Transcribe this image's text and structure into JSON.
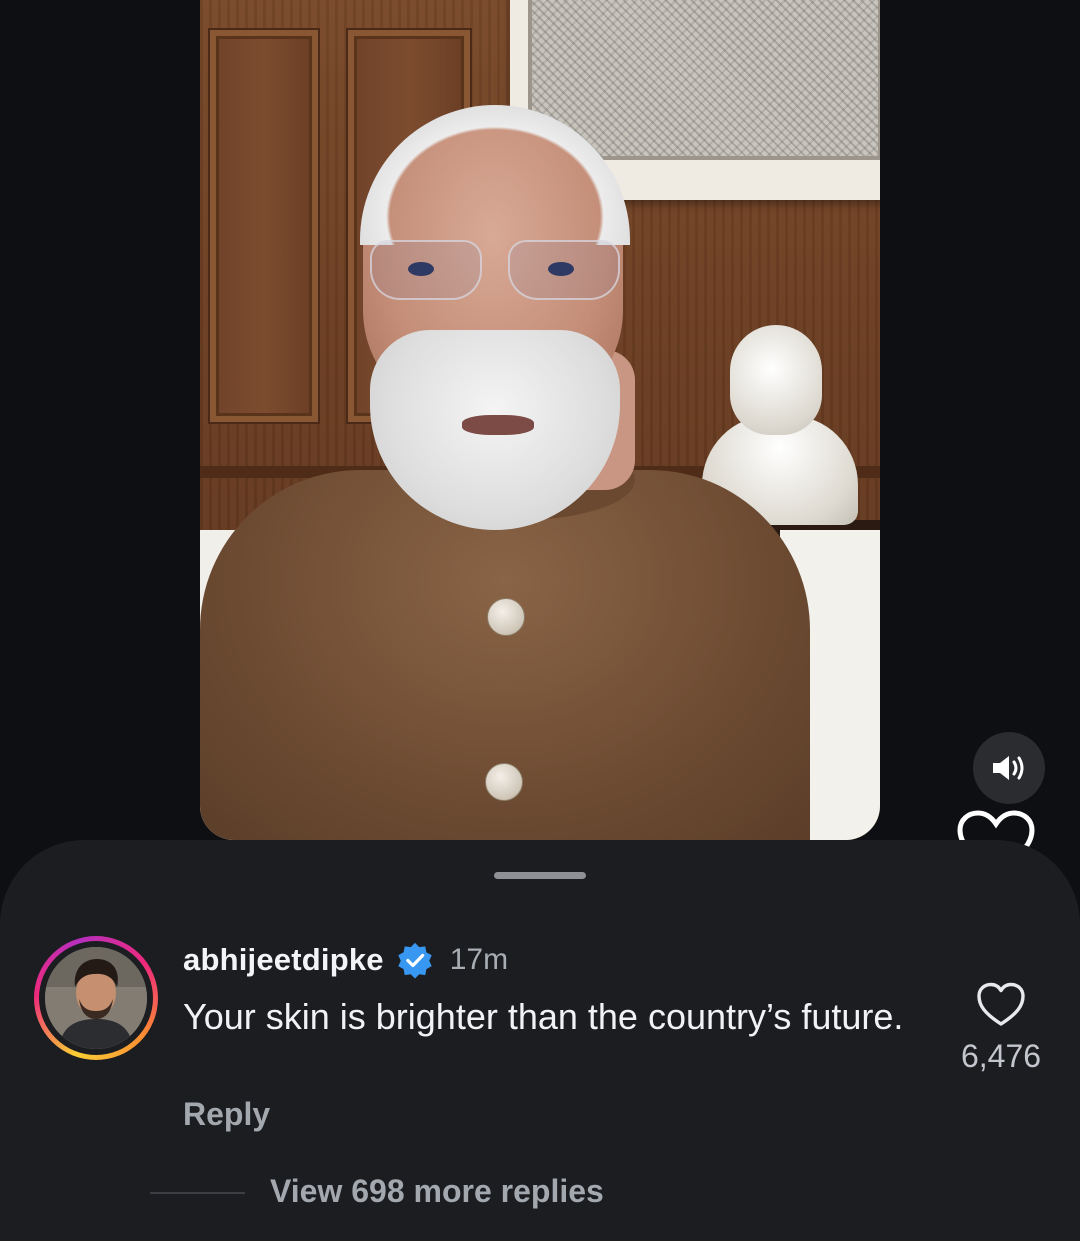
{
  "video": {
    "sound_icon": "speaker-on-icon",
    "like_icon": "heart-outline-icon"
  },
  "comment": {
    "username": "abhijeetdipke",
    "verified_icon": "verified-badge-icon",
    "time": "17m",
    "text": "Your skin is brighter than the country’s future.",
    "reply_label": "Reply",
    "like_icon": "heart-outline-icon",
    "like_count": "6,476"
  },
  "replies": {
    "view_more_label": "View 698 more replies"
  },
  "colors": {
    "background": "#0d0f13",
    "sheet": "#1b1d21",
    "verified": "#3897f0"
  }
}
